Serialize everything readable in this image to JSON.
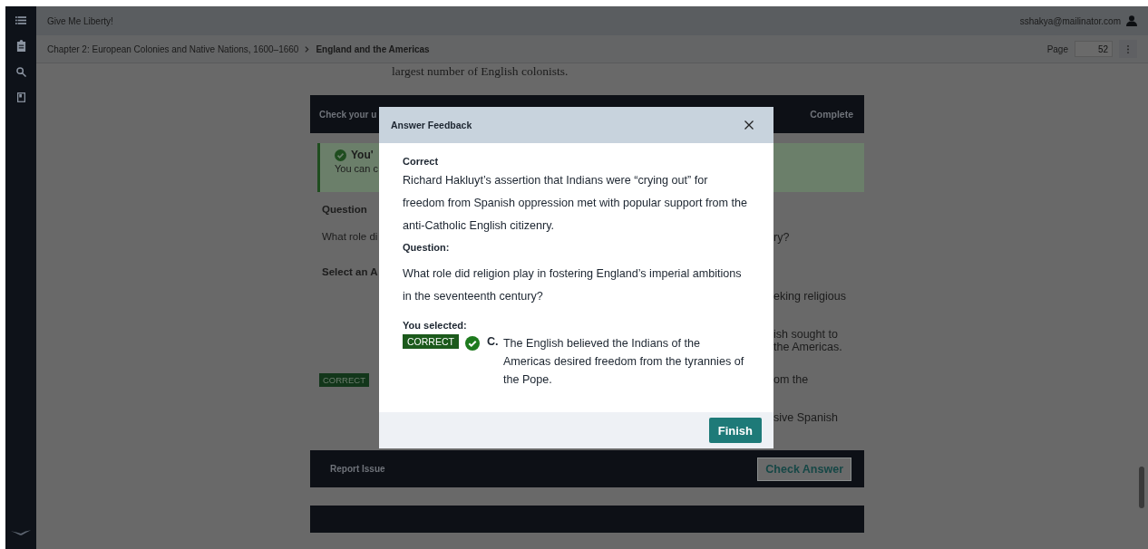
{
  "header": {
    "book_title": "Give Me Liberty!",
    "user": "sshakya@mailinator.com"
  },
  "breadcrumb": [
    {
      "label": "Chapter 2: European Colonies and Native Nations, 1600–1660",
      "current": false
    },
    {
      "label": "England and the Americas",
      "current": true
    }
  ],
  "page_field": {
    "label": "Page",
    "value": "52"
  },
  "content": {
    "intro_text": "largest number of English colonists.",
    "check_bar": {
      "title": "Check your u",
      "status": "Complete"
    },
    "alert": {
      "title": "You'",
      "text": "You can c"
    },
    "question_label": "Question",
    "question_left": "What role di",
    "question_right": "ry?",
    "select_label": "Select an A",
    "options": [
      {
        "kind": "text",
        "lines": [
          "eking religious"
        ]
      },
      {
        "kind": "text",
        "lines": [
          "ish sought to",
          "the Americas."
        ]
      },
      {
        "kind": "correct",
        "badge": "CORRECT",
        "lines": [
          "om the"
        ]
      },
      {
        "kind": "text",
        "lines": [
          "sive Spanish"
        ]
      }
    ],
    "report_bar": {
      "report": "Report Issue",
      "check": "Check Answer"
    }
  },
  "modal": {
    "title": "Answer Feedback",
    "result": "Correct",
    "feedback": "Richard Hakluyt’s assertion that Indians were “crying out” for freedom from Spanish oppression met with popular support from the anti-Catholic English citizenry.",
    "question_label": "Question:",
    "question": "What role did religion play in fostering England’s imperial ambitions in the seventeenth century?",
    "selected_label": "You selected:",
    "badge": "CORRECT",
    "correct": true,
    "letter": "C.",
    "answer": "The English believed the Indians of the Americas desired freedom from the tyrannies of the Pope.",
    "finish": "Finish"
  }
}
